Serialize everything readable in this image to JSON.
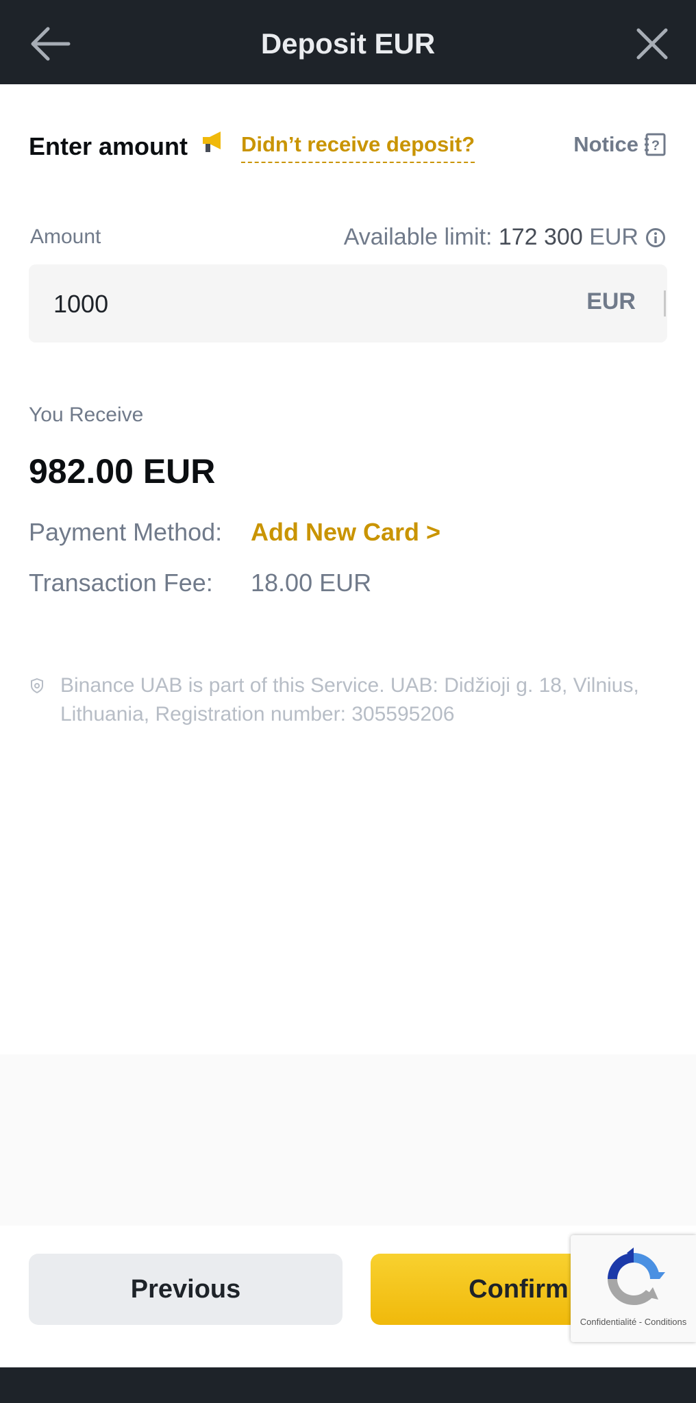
{
  "header": {
    "title": "Deposit EUR",
    "back_icon": "arrow-left-icon",
    "close_icon": "close-icon"
  },
  "enter_amount": {
    "title": "Enter amount",
    "megaphone_icon": "megaphone-icon",
    "not_received_link": "Didn’t receive deposit?",
    "notice_label": "Notice",
    "notice_icon": "question-book-icon"
  },
  "amount": {
    "label": "Amount",
    "limit_label": "Available limit:",
    "limit_value": "172 300",
    "limit_currency": "EUR",
    "info_icon": "info-icon",
    "input_value": "1000",
    "currency": "EUR"
  },
  "receive": {
    "label": "You Receive",
    "value": "982.00 EUR"
  },
  "payment_method": {
    "label": "Payment Method:",
    "value": "Add New Card >"
  },
  "transaction_fee": {
    "label": "Transaction Fee:",
    "value": "18.00 EUR"
  },
  "disclaimer": {
    "icon": "shield-icon",
    "text": "Binance UAB is part of this Service. UAB: Didžioji g. 18, Vilnius, Lithuania, Registration number: 305595206"
  },
  "buttons": {
    "previous": "Previous",
    "confirm": "Confirm"
  },
  "recaptcha": {
    "icon": "recaptcha-icon",
    "privacy": "Confidentialité",
    "separator": "-",
    "terms": "Conditions"
  },
  "colors": {
    "header_bg": "#1e2329",
    "accent": "#c99400",
    "primary_button": "#f0b90b",
    "secondary_button": "#eaecef"
  }
}
